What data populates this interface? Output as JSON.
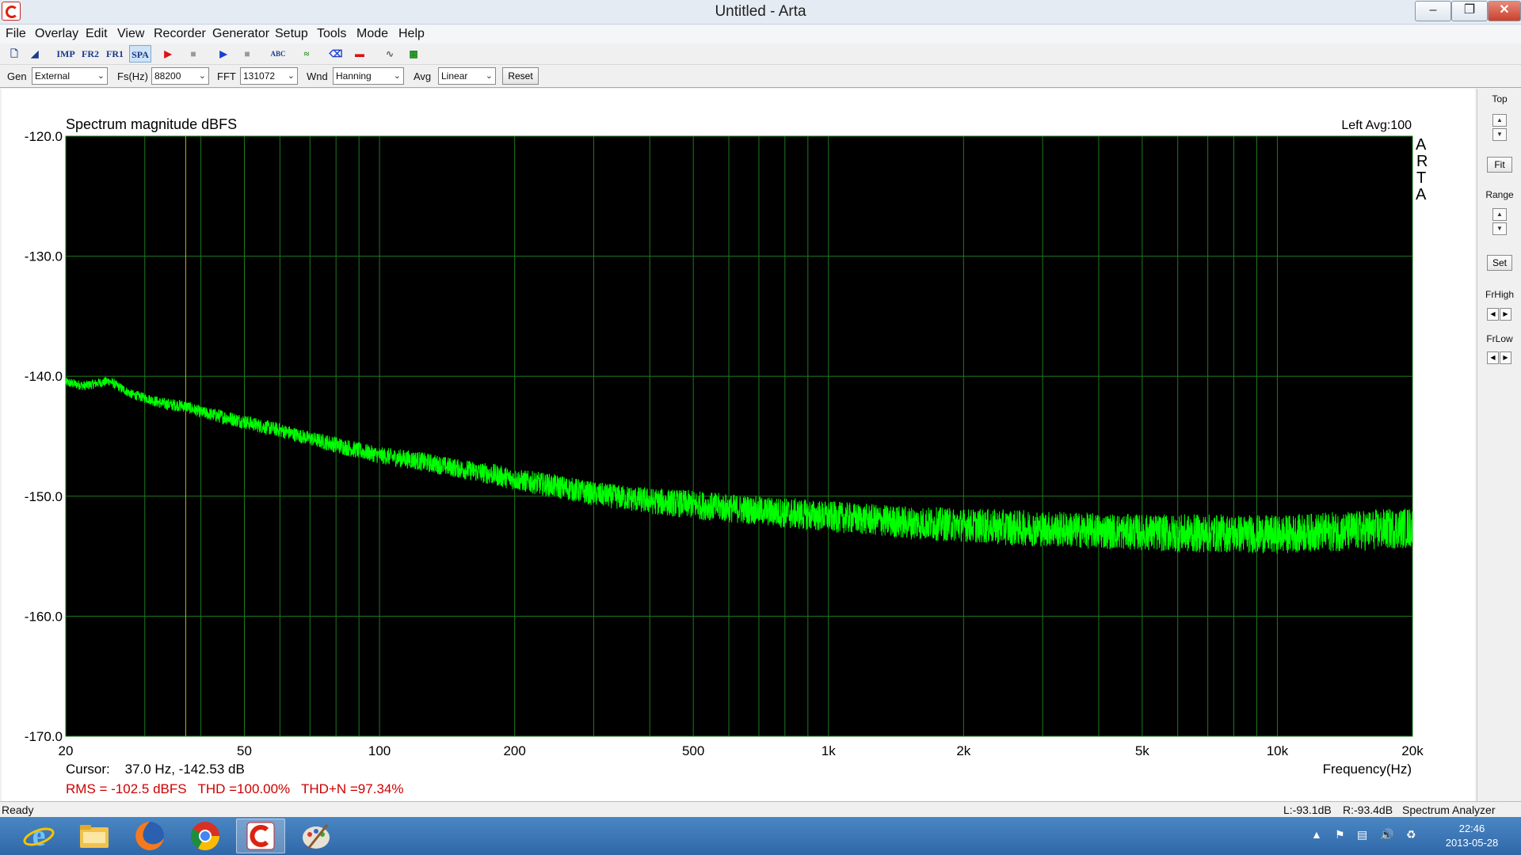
{
  "window": {
    "title": "Untitled - Arta"
  },
  "menu": [
    "File",
    "Overlay",
    "Edit",
    "View",
    "Recorder",
    "Generator",
    "Setup",
    "Tools",
    "Mode",
    "Help"
  ],
  "toolbar": {
    "imp": "IMP",
    "fr2": "FR2",
    "fr1": "FR1",
    "spa": "SPA"
  },
  "controls": {
    "gen_label": "Gen",
    "gen_value": "External",
    "fs_label": "Fs(Hz)",
    "fs_value": "88200",
    "fft_label": "FFT",
    "fft_value": "131072",
    "wnd_label": "Wnd",
    "wnd_value": "Hanning",
    "avg_label": "Avg",
    "avg_value": "Linear",
    "reset_label": "Reset"
  },
  "plot": {
    "channel_avg": "Left  Avg:100",
    "arta_letters": [
      "A",
      "R",
      "T",
      "A"
    ],
    "cursor_text": "Cursor:    37.0 Hz, -142.53 dB",
    "measure_text": "RMS = -102.5 dBFS   THD =100.00%   THD+N =97.34%",
    "background": "#000000",
    "grid_color": "#1f7a1f",
    "trace_color": "#00ff00",
    "cursor_color": "#d4b000",
    "measure_color": "#cc0000"
  },
  "chart_data": {
    "type": "line",
    "title": "Spectrum magnitude dBFS",
    "xlabel": "Frequency(Hz)",
    "ylabel": "",
    "x_scale": "log",
    "xlim": [
      20,
      20000
    ],
    "ylim": [
      -170,
      -120
    ],
    "x_ticks": [
      {
        "value": 20,
        "label": "20"
      },
      {
        "value": 50,
        "label": "50"
      },
      {
        "value": 100,
        "label": "100"
      },
      {
        "value": 200,
        "label": "200"
      },
      {
        "value": 500,
        "label": "500"
      },
      {
        "value": 1000,
        "label": "1k"
      },
      {
        "value": 2000,
        "label": "2k"
      },
      {
        "value": 5000,
        "label": "5k"
      },
      {
        "value": 10000,
        "label": "10k"
      },
      {
        "value": 20000,
        "label": "20k"
      }
    ],
    "y_ticks": [
      {
        "value": -120,
        "label": "-120.0"
      },
      {
        "value": -130,
        "label": "-130.0"
      },
      {
        "value": -140,
        "label": "-140.0"
      },
      {
        "value": -150,
        "label": "-150.0"
      },
      {
        "value": -160,
        "label": "-160.0"
      },
      {
        "value": -170,
        "label": "-170.0"
      }
    ],
    "grid": true,
    "cursor_x": 37.0,
    "series": [
      {
        "x": [
          20,
          22,
          25,
          28,
          30,
          33,
          37,
          40,
          45,
          50,
          55,
          60,
          70,
          80,
          90,
          100,
          120,
          150,
          180,
          200,
          250,
          300,
          400,
          500,
          600,
          700,
          800,
          1000,
          1200,
          1500,
          2000,
          2500,
          3000,
          4000,
          5000,
          6000,
          8000,
          10000,
          12000,
          15000,
          20000
        ],
        "y": [
          -140.5,
          -140.8,
          -140.4,
          -141.5,
          -141.8,
          -142.3,
          -142.5,
          -143.0,
          -143.4,
          -143.8,
          -144.2,
          -144.5,
          -145.2,
          -145.7,
          -146.2,
          -146.6,
          -147.0,
          -147.7,
          -148.2,
          -148.6,
          -149.2,
          -149.8,
          -150.4,
          -150.7,
          -151.0,
          -151.2,
          -151.4,
          -151.7,
          -151.9,
          -152.2,
          -152.4,
          -152.6,
          -152.7,
          -152.9,
          -153.0,
          -153.1,
          -153.1,
          -153.2,
          -153.0,
          -152.9,
          -152.6
        ],
        "noise": [
          0.4,
          0.4,
          0.4,
          0.4,
          0.4,
          0.5,
          0.5,
          0.5,
          0.6,
          0.6,
          0.6,
          0.6,
          0.6,
          0.7,
          0.7,
          0.7,
          0.8,
          0.8,
          0.9,
          0.9,
          1.0,
          1.0,
          1.1,
          1.2,
          1.2,
          1.2,
          1.3,
          1.3,
          1.3,
          1.4,
          1.4,
          1.5,
          1.5,
          1.5,
          1.5,
          1.6,
          1.6,
          1.6,
          1.6,
          1.7,
          1.7
        ]
      }
    ]
  },
  "status": {
    "ready": "Ready",
    "left_level": "L:-93.1dB",
    "right_level": "R:-93.4dB",
    "mode": "Spectrum Analyzer"
  },
  "right_panel": {
    "top": "Top",
    "fit": "Fit",
    "range": "Range",
    "set": "Set",
    "frhigh": "FrHigh",
    "frlow": "FrLow"
  },
  "clock": {
    "time": "22:46",
    "date": "2013-05-28"
  }
}
